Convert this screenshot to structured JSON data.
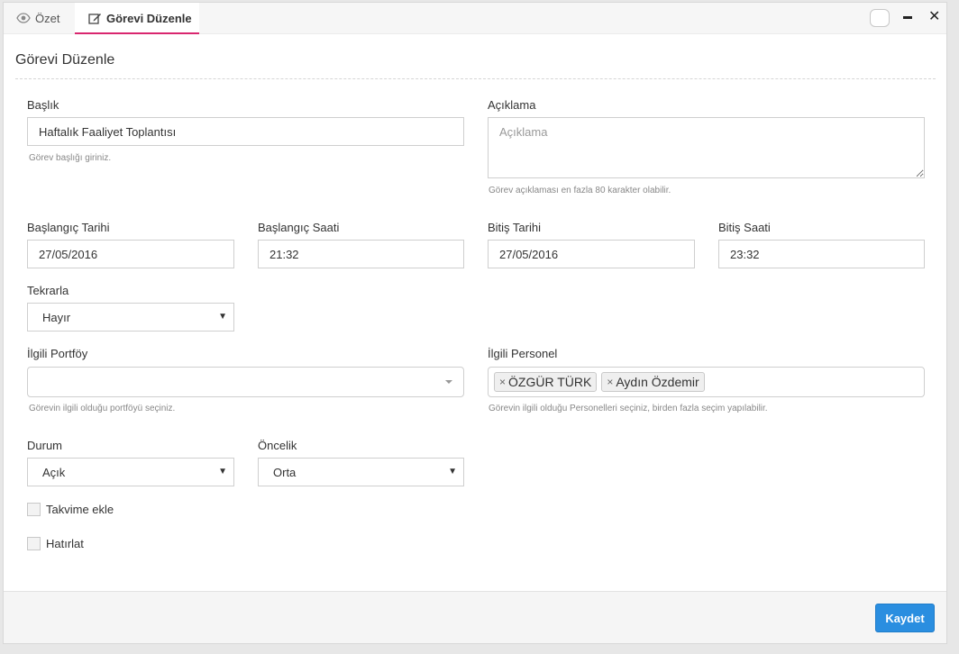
{
  "tabs": {
    "overview": "Özet",
    "edit": "Görevi Düzenle"
  },
  "page_title": "Görevi Düzenle",
  "form": {
    "title": {
      "label": "Başlık",
      "value": "Haftalık Faaliyet Toplantısı",
      "help": "Görev başlığı giriniz."
    },
    "description": {
      "label": "Açıklama",
      "placeholder": "Açıklama",
      "help": "Görev açıklaması en fazla 80 karakter olabilir."
    },
    "start_date": {
      "label": "Başlangıç Tarihi",
      "value": "27/05/2016"
    },
    "start_time": {
      "label": "Başlangıç Saati",
      "value": "21:32"
    },
    "end_date": {
      "label": "Bitiş Tarihi",
      "value": "27/05/2016"
    },
    "end_time": {
      "label": "Bitiş Saati",
      "value": "23:32"
    },
    "repeat": {
      "label": "Tekrarla",
      "value": "Hayır"
    },
    "portfolio": {
      "label": "İlgili Portföy",
      "value": "",
      "help": "Görevin ilgili olduğu portföyü seçiniz."
    },
    "personnel": {
      "label": "İlgili Personel",
      "tags": [
        "ÖZGÜR TÜRK",
        "Aydın Özdemir"
      ],
      "help": "Görevin ilgili olduğu Personelleri seçiniz, birden fazla seçim yapılabilir."
    },
    "status": {
      "label": "Durum",
      "value": "Açık"
    },
    "priority": {
      "label": "Öncelik",
      "value": "Orta"
    },
    "add_calendar": {
      "label": "Takvime ekle",
      "checked": false
    },
    "remind": {
      "label": "Hatırlat",
      "checked": false
    }
  },
  "footer": {
    "save_label": "Kaydet"
  },
  "colors": {
    "accent": "#d9266f",
    "primary_button": "#2a8ee0"
  }
}
